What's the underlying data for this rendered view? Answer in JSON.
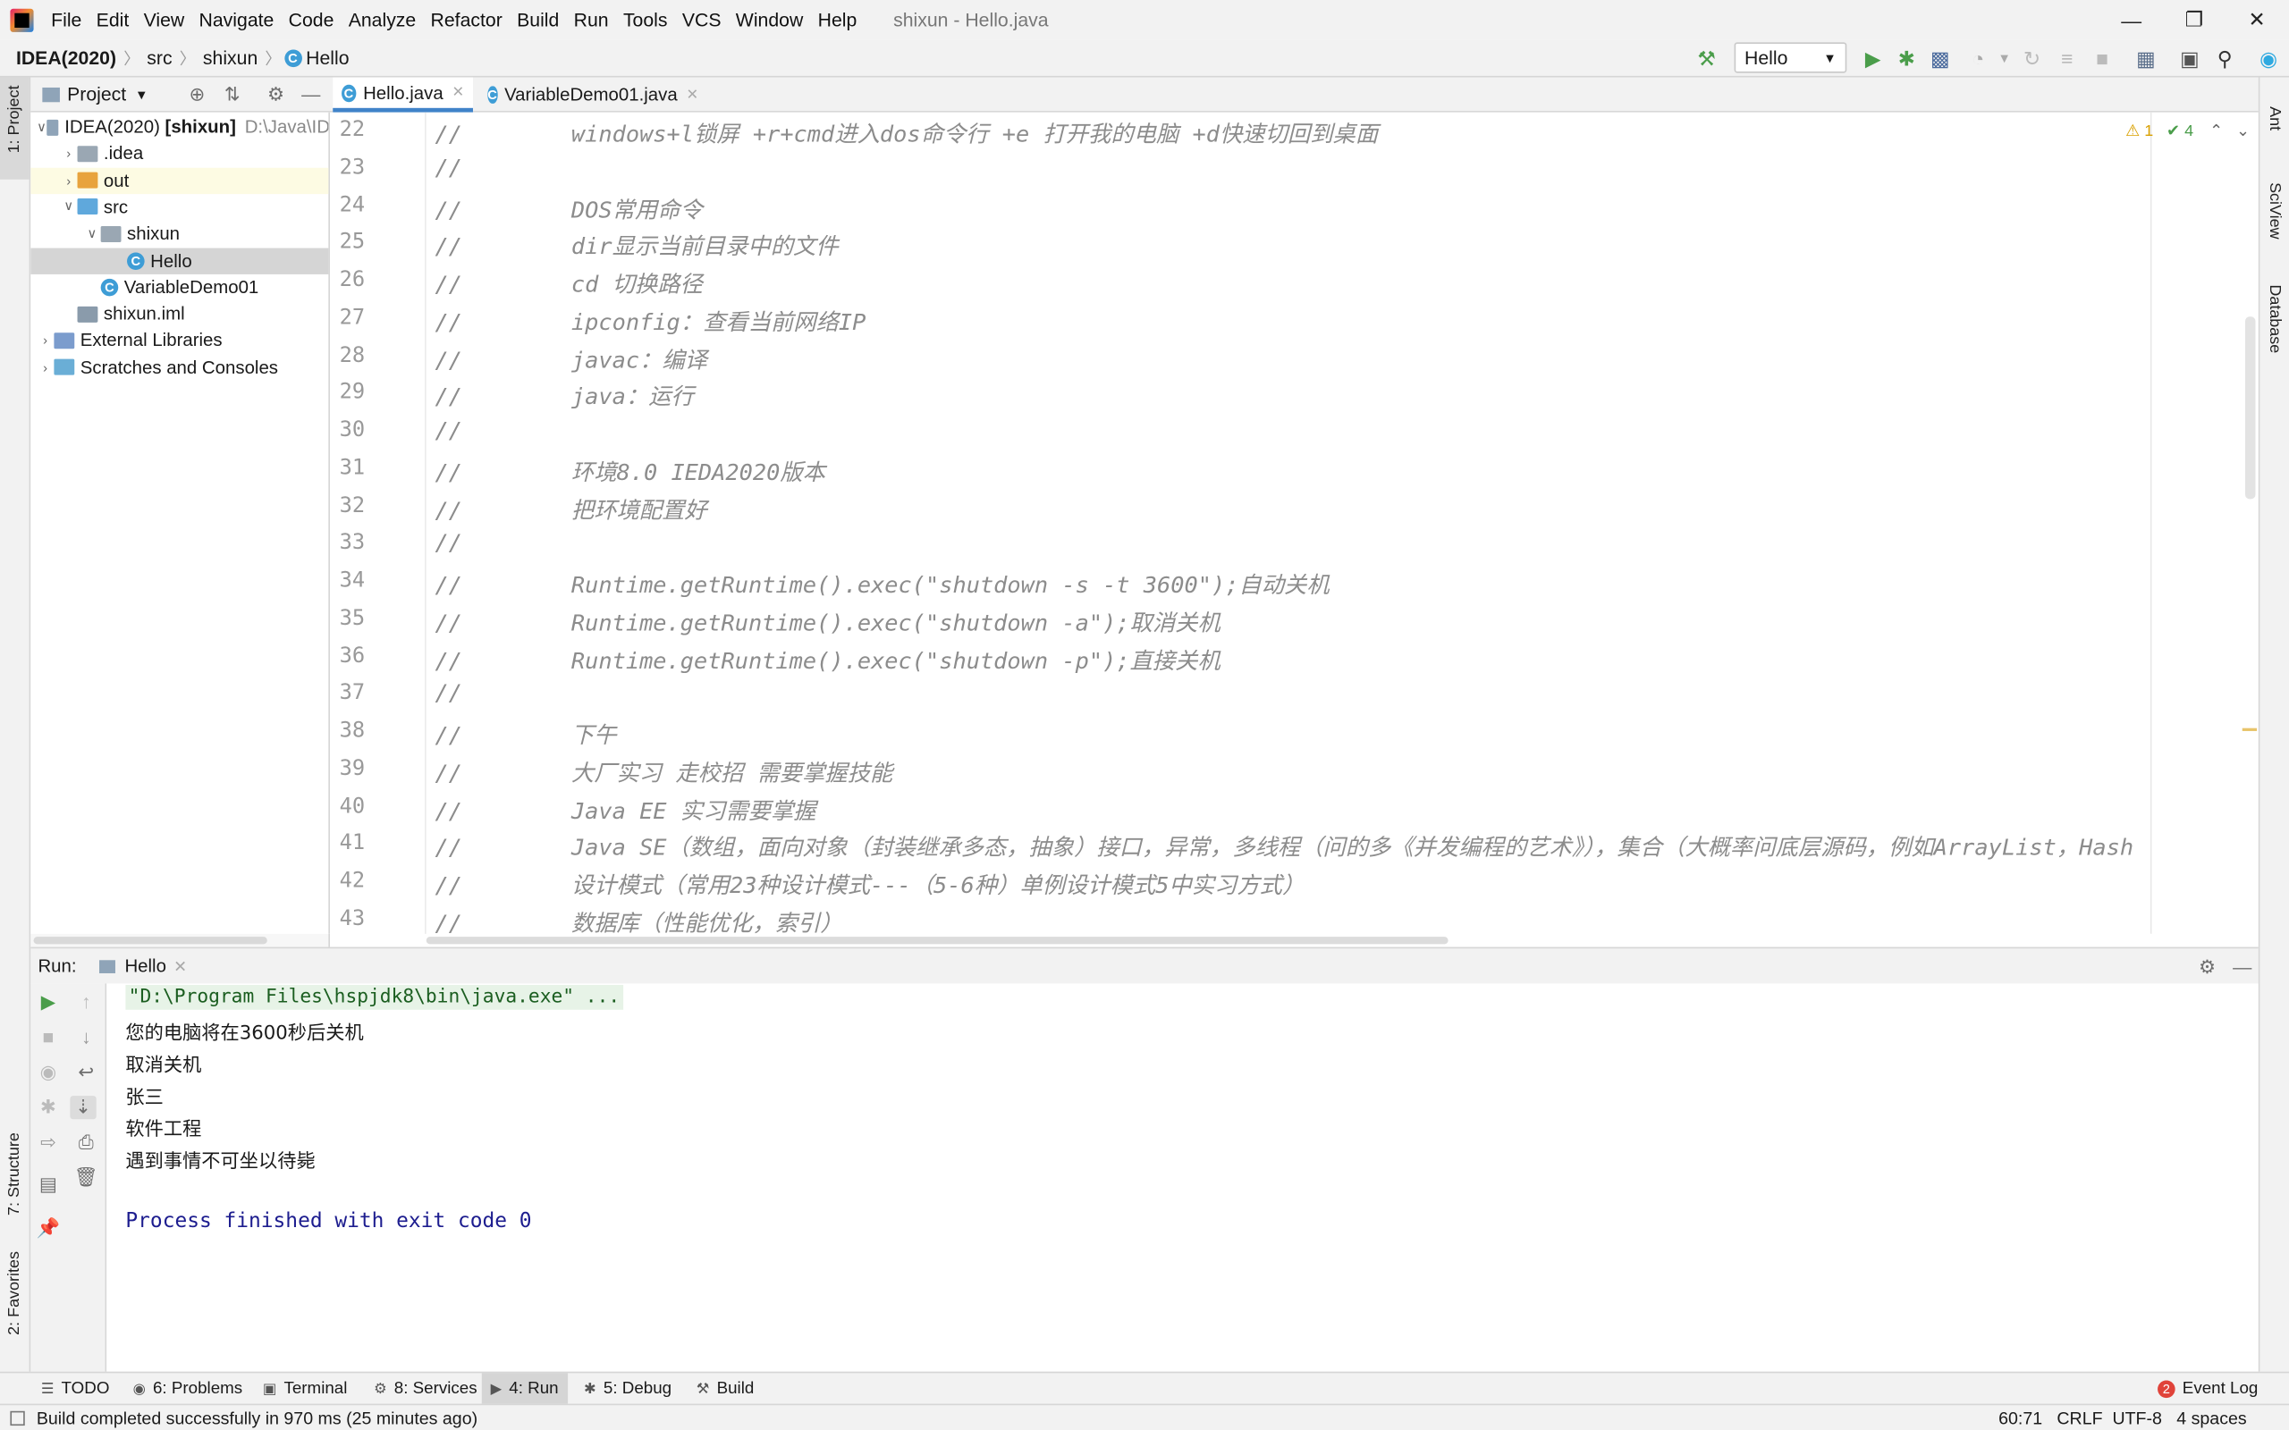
{
  "window": {
    "title": "shixun - Hello.java"
  },
  "menu": [
    "File",
    "Edit",
    "View",
    "Navigate",
    "Code",
    "Analyze",
    "Refactor",
    "Build",
    "Run",
    "Tools",
    "VCS",
    "Window",
    "Help"
  ],
  "breadcrumb": [
    "IDEA(2020)",
    "src",
    "shixun",
    "Hello"
  ],
  "run_config": "Hello",
  "project_panel": {
    "title": "Project",
    "tree": [
      {
        "label": "IDEA(2020) [shixun]",
        "suffix": "D:\\Java\\ID",
        "depth": 0,
        "expanded": true,
        "kind": "module"
      },
      {
        "label": ".idea",
        "depth": 1,
        "expanded": false,
        "kind": "folder"
      },
      {
        "label": "out",
        "depth": 1,
        "expanded": false,
        "kind": "folder-orange"
      },
      {
        "label": "src",
        "depth": 1,
        "expanded": true,
        "kind": "folder-blue"
      },
      {
        "label": "shixun",
        "depth": 2,
        "expanded": true,
        "kind": "package"
      },
      {
        "label": "Hello",
        "depth": 3,
        "kind": "class"
      },
      {
        "label": "VariableDemo01",
        "depth": 2,
        "kind": "class"
      },
      {
        "label": "shixun.iml",
        "depth": 1,
        "kind": "file"
      },
      {
        "label": "External Libraries",
        "depth": 0,
        "expanded": false,
        "kind": "lib"
      },
      {
        "label": "Scratches and Consoles",
        "depth": 0,
        "expanded": false,
        "kind": "scratch"
      }
    ]
  },
  "editor": {
    "tabs": [
      {
        "label": "Hello.java",
        "active": true
      },
      {
        "label": "VariableDemo01.java",
        "active": false
      }
    ],
    "inspection": {
      "warnings": "1",
      "weak": "4"
    },
    "lines": [
      {
        "n": "22",
        "c": "//        windows+l锁屏 +r+cmd进入dos命令行 +e 打开我的电脑 +d快速切回到桌面"
      },
      {
        "n": "23",
        "c": "//"
      },
      {
        "n": "24",
        "c": "//        DOS常用命令"
      },
      {
        "n": "25",
        "c": "//        dir显示当前目录中的文件"
      },
      {
        "n": "26",
        "c": "//        cd 切换路径"
      },
      {
        "n": "27",
        "c": "//        ipconfig：查看当前网络IP"
      },
      {
        "n": "28",
        "c": "//        javac：编译"
      },
      {
        "n": "29",
        "c": "//        java：运行"
      },
      {
        "n": "30",
        "c": "//"
      },
      {
        "n": "31",
        "c": "//        环境8.0 IEDA2020版本"
      },
      {
        "n": "32",
        "c": "//        把环境配置好"
      },
      {
        "n": "33",
        "c": "//"
      },
      {
        "n": "34",
        "c": "//        Runtime.getRuntime().exec(\"shutdown -s -t 3600\");自动关机"
      },
      {
        "n": "35",
        "c": "//        Runtime.getRuntime().exec(\"shutdown -a\");取消关机"
      },
      {
        "n": "36",
        "c": "//        Runtime.getRuntime().exec(\"shutdown -p\");直接关机"
      },
      {
        "n": "37",
        "c": "//"
      },
      {
        "n": "38",
        "c": "//        下午"
      },
      {
        "n": "39",
        "c": "//        大厂实习 走校招 需要掌握技能"
      },
      {
        "n": "40",
        "c": "//        Java EE 实习需要掌握"
      },
      {
        "n": "41",
        "c": "//        Java SE（数组，面向对象（封装继承多态，抽象）接口，异常，多线程（问的多《并发编程的艺术》），集合（大概率问底层源码，例如ArrayList，Hash"
      },
      {
        "n": "42",
        "c": "//        设计模式（常用23种设计模式---（5-6种）单例设计模式5中实习方式）"
      },
      {
        "n": "43",
        "c": "//        数据库（性能优化，索引）"
      }
    ]
  },
  "run_panel": {
    "label": "Run:",
    "tab": "Hello",
    "output": [
      {
        "text": "\"D:\\Program Files\\hspjdk8\\bin\\java.exe\" ...",
        "kind": "cmd"
      },
      {
        "text": "您的电脑将在3600秒后关机",
        "kind": "out"
      },
      {
        "text": "取消关机",
        "kind": "out"
      },
      {
        "text": "张三",
        "kind": "out"
      },
      {
        "text": "软件工程",
        "kind": "out"
      },
      {
        "text": "遇到事情不可坐以待毙",
        "kind": "out"
      },
      {
        "text": "",
        "kind": "out"
      },
      {
        "text": "Process finished with exit code 0",
        "kind": "exit"
      }
    ]
  },
  "side_tools": {
    "left": [
      "1: Project",
      "7: Structure",
      "2: Favorites"
    ],
    "right": [
      "Ant",
      "SciView",
      "Database"
    ]
  },
  "tool_windows": [
    {
      "label": "TODO",
      "icon": "list-icon"
    },
    {
      "label": "6: Problems",
      "icon": "problems-icon"
    },
    {
      "label": "Terminal",
      "icon": "terminal-icon"
    },
    {
      "label": "8: Services",
      "icon": "services-icon"
    },
    {
      "label": "4: Run",
      "icon": "run-icon",
      "active": true
    },
    {
      "label": "5: Debug",
      "icon": "bug-icon"
    },
    {
      "label": "Build",
      "icon": "hammer-icon"
    }
  ],
  "event_log": {
    "label": "Event Log",
    "count": "2"
  },
  "status": {
    "message": "Build completed successfully in 970 ms (25 minutes ago)",
    "position": "60:71",
    "line_sep": "CRLF",
    "encoding": "UTF-8",
    "indent": "4 spaces"
  },
  "colors": {
    "accent": "#3e9dd6",
    "run_green": "#4a9d4a",
    "exit_blue": "#1d1d8f",
    "selection": "#d5d5d5"
  }
}
